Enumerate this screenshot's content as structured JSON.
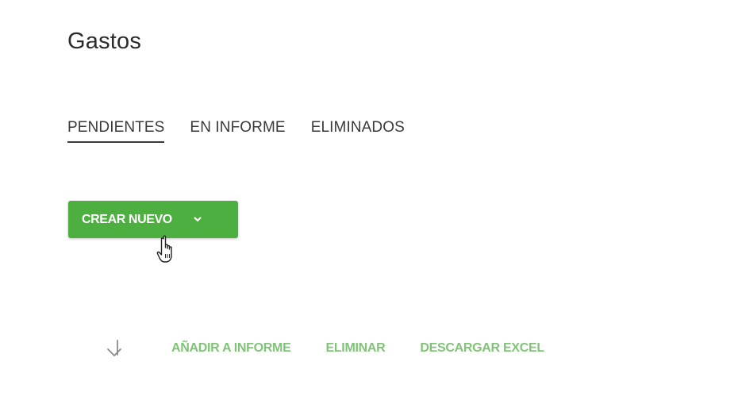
{
  "page": {
    "title": "Gastos"
  },
  "tabs": [
    {
      "label": "PENDIENTES",
      "active": true
    },
    {
      "label": "EN INFORME",
      "active": false
    },
    {
      "label": "ELIMINADOS",
      "active": false
    }
  ],
  "create_button": {
    "label": "CREAR NUEVO",
    "icon": "chevron-down-icon",
    "color": "#4caf3f"
  },
  "toolbar": {
    "sort_icon": "arrow-down-icon",
    "actions": [
      {
        "label": "AÑADIR A INFORME"
      },
      {
        "label": "ELIMINAR"
      },
      {
        "label": "DESCARGAR EXCEL"
      }
    ],
    "action_color": "#7fc476"
  }
}
